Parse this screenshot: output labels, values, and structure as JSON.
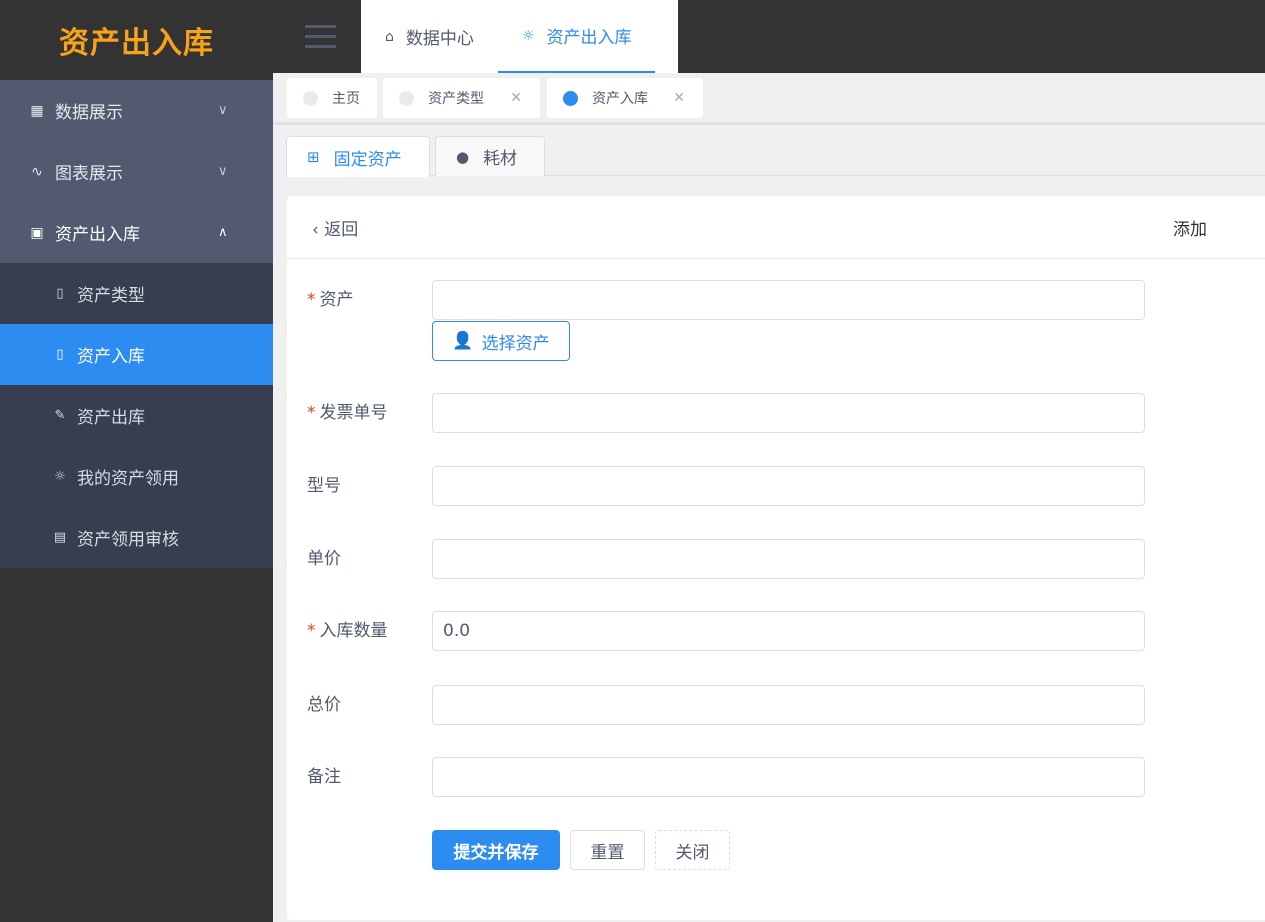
{
  "logo": "资产出入库",
  "sidebar": {
    "menus": [
      {
        "label": "数据展示",
        "icon": "grid-icon"
      },
      {
        "label": "图表展示",
        "icon": "pulse-icon"
      },
      {
        "label": "资产出入库",
        "icon": "archive-icon"
      }
    ],
    "sub": [
      {
        "label": "资产类型"
      },
      {
        "label": "资产入库"
      },
      {
        "label": "资产出库"
      },
      {
        "label": "我的资产领用"
      },
      {
        "label": "资产领用审核"
      }
    ]
  },
  "top": {
    "tabs": [
      {
        "label": "数据中心"
      },
      {
        "label": "资产出入库"
      }
    ]
  },
  "tags": [
    {
      "label": "主页"
    },
    {
      "label": "资产类型"
    },
    {
      "label": "资产入库"
    }
  ],
  "subtabs": [
    {
      "label": "固定资产"
    },
    {
      "label": "耗材"
    }
  ],
  "card": {
    "back": "返回",
    "title": "添加"
  },
  "form": {
    "asset": "资产",
    "pick": "选择资产",
    "invoice": "发票单号",
    "model": "型号",
    "price": "单价",
    "qty": "入库数量",
    "qty_value": "0.0",
    "total": "总价",
    "remark": "备注",
    "submit": "提交并保存",
    "reset": "重置",
    "close": "关闭"
  },
  "colors": {
    "accent": "#2d8cf0",
    "logo": "#f7a21b"
  }
}
